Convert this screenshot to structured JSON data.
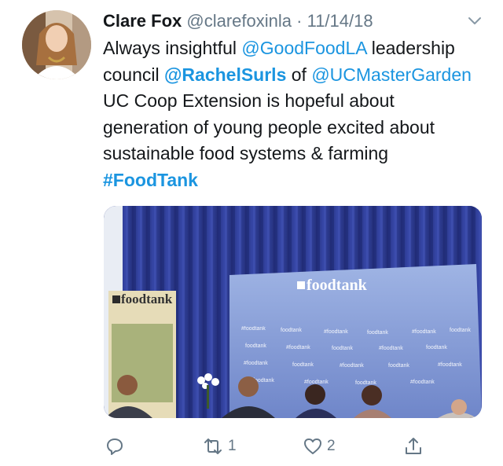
{
  "tweet": {
    "author_name": "Clare Fox",
    "handle": "@clarefoxinla",
    "separator": "·",
    "date": "11/14/18",
    "text": {
      "part1": "Always insightful ",
      "mention1": "@GoodFoodLA",
      "part2": " leadership council ",
      "mention2": "@RachelSurls",
      "part3": " of ",
      "mention3": "@UCMasterGarden",
      "part4": " UC Coop Extension is hopeful about generation of young people excited about sustainable food systems & farming ",
      "hashtag": "#FoodTank"
    },
    "media": {
      "backdrop_logo": "foodtank",
      "banner_logo": "foodtank",
      "backdrop_tile_text": "#foodtank",
      "backdrop_tile_text_alt": "foodtank"
    },
    "actions": {
      "reply_icon": "reply-icon",
      "retweet_icon": "retweet-icon",
      "retweet_count": "1",
      "like_icon": "heart-icon",
      "like_count": "2",
      "share_icon": "share-icon"
    }
  },
  "colors": {
    "link": "#1b95e0",
    "secondary_text": "#657786",
    "primary_text": "#14171a",
    "curtain": "#2f3c95"
  }
}
